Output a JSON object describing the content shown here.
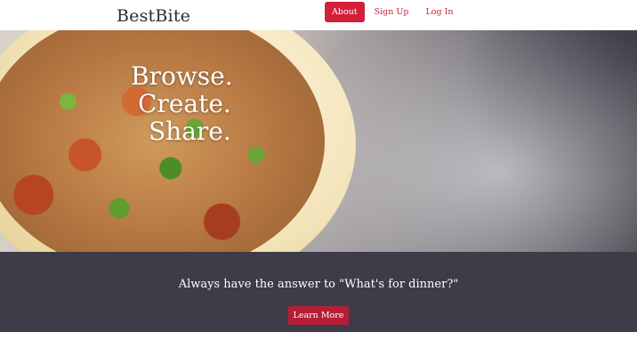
{
  "navbar": {
    "brand": "BestBite",
    "links": [
      {
        "label": "About",
        "active": true
      },
      {
        "label": "Sign Up",
        "active": false
      },
      {
        "label": "Log In",
        "active": false
      }
    ]
  },
  "hero": {
    "headline": [
      "Browse.",
      "Create.",
      "Share."
    ]
  },
  "cta": {
    "text": "Always have the answer to \"What's for dinner?\"",
    "button_label": "Learn More"
  },
  "colors": {
    "accent": "#d41f3b",
    "cta_band": "#3d3c48",
    "cta_button": "#b51e36"
  }
}
